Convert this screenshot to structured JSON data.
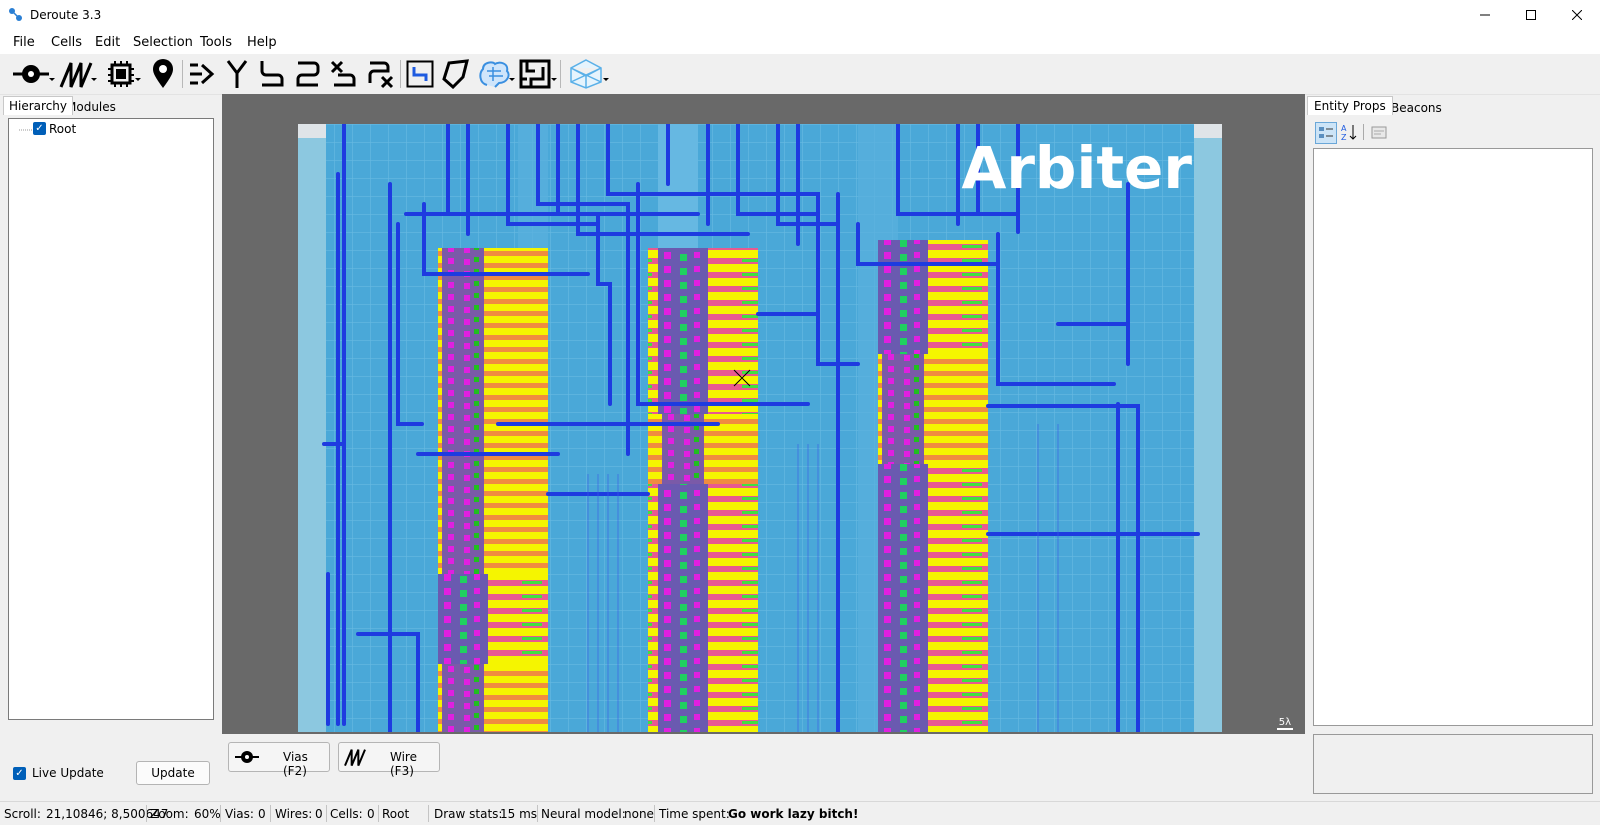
{
  "window": {
    "title": "Deroute 3.3"
  },
  "menu": [
    "File",
    "Cells",
    "Edit",
    "Selection",
    "Tools",
    "Help"
  ],
  "toolbar": {
    "icons": [
      "via-tool-icon",
      "wire-tool-icon",
      "cell-tool-icon",
      "beacon-pin-icon",
      "wire-in-icon",
      "wire-fork-icon",
      "wire-route-icon",
      "wire-route2-icon",
      "wire-cross-icon",
      "wire-delete-icon",
      "select-box-icon",
      "polygon-icon",
      "neural-brain-icon",
      "maze-router-icon",
      "3d-view-icon"
    ]
  },
  "left_panel": {
    "tabs": [
      "Hierarchy",
      "Modules"
    ],
    "tree_root": "Root",
    "live_update_label": "Live Update",
    "update_button": "Update"
  },
  "canvas": {
    "overlay_title": "Arbiter",
    "scale_label": "5λ"
  },
  "modes": [
    {
      "label": "Vias (F2)",
      "icon": "via-mode-icon"
    },
    {
      "label": "Wire (F3)",
      "icon": "wire-mode-icon"
    }
  ],
  "right_panel": {
    "tabs": [
      "Entity Props",
      "Beacons"
    ]
  },
  "status": {
    "scroll_label": "Scroll:",
    "scroll_value": "21,10846; 8,500647",
    "zoom_label": "Zoom:",
    "zoom_value": "60%",
    "vias_label": "Vias:",
    "vias_value": "0",
    "wires_label": "Wires:",
    "wires_value": "0",
    "cells_label": "Cells:",
    "cells_value": "0",
    "module": "Root",
    "draw_label": "Draw stats:",
    "draw_value": "15 ms",
    "neural_label": "Neural model:",
    "neural_value": "none",
    "time_label": "Time spent:",
    "time_value": "Go work lazy bitch!"
  },
  "colors": {
    "accent": "#005fb8",
    "wire": "#1e3be0",
    "substrate": "#4aa8d8",
    "cell_yellow": "#f5f500",
    "cell_magenta": "#e020e0"
  }
}
